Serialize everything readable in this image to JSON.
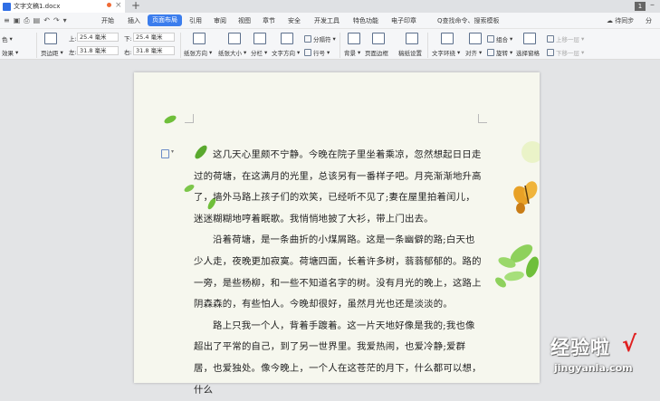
{
  "titlebar": {
    "doc_title": "文字文稿1.docx",
    "new_tab": "+",
    "badge": "1"
  },
  "menubar": {
    "items": [
      {
        "label": "开始",
        "active": false
      },
      {
        "label": "插入",
        "active": false
      },
      {
        "label": "页面布局",
        "active": true
      },
      {
        "label": "引用",
        "active": false
      },
      {
        "label": "审阅",
        "active": false
      },
      {
        "label": "视图",
        "active": false
      },
      {
        "label": "章节",
        "active": false
      },
      {
        "label": "安全",
        "active": false
      },
      {
        "label": "开发工具",
        "active": false
      },
      {
        "label": "特色功能",
        "active": false
      },
      {
        "label": "电子印章",
        "active": false
      }
    ],
    "search": "Q查找命令、搜索模板",
    "sync": "待同步",
    "share": "分"
  },
  "ribbon": {
    "color_label": "色",
    "effect_label": "效果",
    "margins_label": "页边距",
    "top_label": "上:",
    "top_value": "25.4 毫米",
    "bottom_label": "下:",
    "bottom_value": "25.4 毫米",
    "left_label": "左:",
    "left_value": "31.8 毫米",
    "right_label": "右:",
    "right_value": "31.8 毫米",
    "orientation": "纸张方向",
    "size": "纸张大小",
    "columns": "分栏",
    "text_direction": "文字方向",
    "breaks": "分隔符",
    "line_numbers": "行号",
    "background": "背景",
    "page_border": "页面边框",
    "manuscript": "稿纸设置",
    "wrap": "文字环绕",
    "align": "对齐",
    "group": "组合",
    "rotate": "旋转",
    "selection_pane": "选择窗格",
    "bring_forward": "上移一层",
    "send_backward": "下移一层"
  },
  "document": {
    "paragraphs": [
      "这几天心里颇不宁静。今晚在院子里坐着乘凉，忽然想起日日走过的荷塘，在这满月的光里，总该另有一番样子吧。月亮渐渐地升高了，墙外马路上孩子们的欢笑，已经听不见了;妻在屋里拍着闰儿，迷迷糊糊地哼着眠歌。我悄悄地披了大衫，带上门出去。",
      "沿着荷塘，是一条曲折的小煤屑路。这是一条幽僻的路;白天也少人走，夜晚更加寂寞。荷塘四面，长着许多树，蓊蓊郁郁的。路的一旁，是些杨柳，和一些不知道名字的树。没有月光的晚上，这路上阴森森的，有些怕人。今晚却很好，虽然月光也还是淡淡的。",
      "路上只我一个人，背着手踱着。这一片天地好像是我的;我也像超出了平常的自己，到了另一世界里。我爱热闹，也爱冷静;爱群居，也爱独处。像今晚上，一个人在这苍茫的月下，什么都可以想，什么"
    ]
  },
  "watermark": {
    "brand": "经验啦",
    "check": "√",
    "url": "jingyanla.com"
  },
  "colors": {
    "accent": "#3b7ded",
    "page_bg": "#f6f7ee",
    "leaf": "#6fbf3a",
    "butterfly": "#e8a126"
  }
}
